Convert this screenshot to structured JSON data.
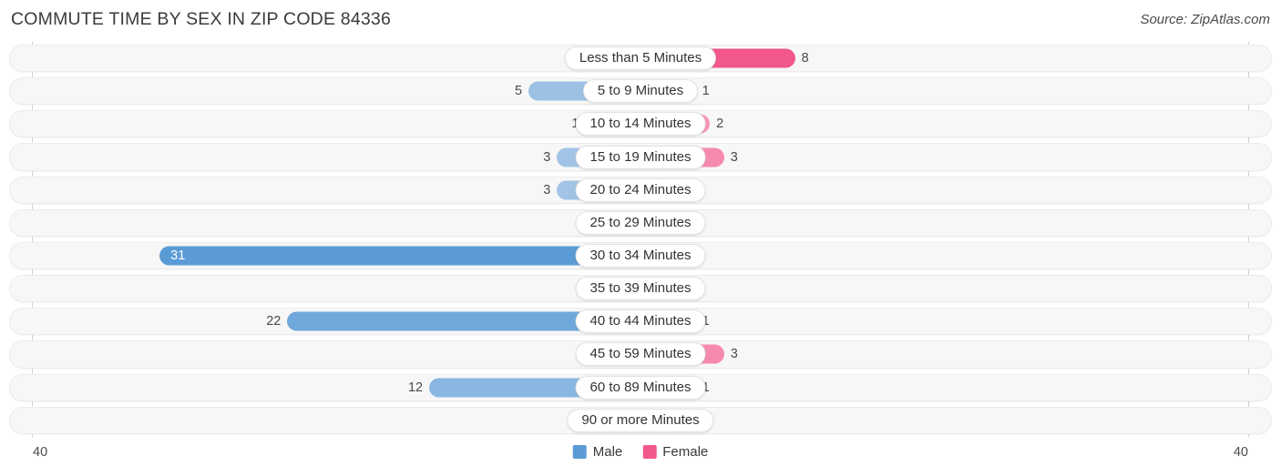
{
  "header": {
    "title": "COMMUTE TIME BY SEX IN ZIP CODE 84336",
    "source": "Source: ZipAtlas.com"
  },
  "legend": {
    "male_label": "Male",
    "female_label": "Female",
    "male_color": "#5b9bd5",
    "female_color": "#f2578d"
  },
  "axis": {
    "left_tick": "40",
    "right_tick": "40"
  },
  "chart_data": {
    "type": "bar",
    "title": "COMMUTE TIME BY SEX IN ZIP CODE 84336",
    "subtitle": "Source: ZipAtlas.com",
    "orientation": "horizontal-diverging",
    "xlabel": "",
    "ylabel": "",
    "xlim": [
      -40,
      40
    ],
    "axis_ticks": [
      "40",
      "40"
    ],
    "grid": false,
    "legend_position": "bottom-center",
    "categories": [
      "Less than 5 Minutes",
      "5 to 9 Minutes",
      "10 to 14 Minutes",
      "15 to 19 Minutes",
      "20 to 24 Minutes",
      "25 to 29 Minutes",
      "30 to 34 Minutes",
      "35 to 39 Minutes",
      "40 to 44 Minutes",
      "45 to 59 Minutes",
      "60 to 89 Minutes",
      "90 or more Minutes"
    ],
    "series": [
      {
        "name": "Male",
        "color": "#5b9bd5",
        "direction": "left",
        "values": [
          0,
          5,
          1,
          3,
          3,
          0,
          31,
          0,
          22,
          0,
          12,
          1
        ]
      },
      {
        "name": "Female",
        "color": "#f2578d",
        "direction": "right",
        "values": [
          8,
          1,
          2,
          3,
          0,
          0,
          0,
          0,
          1,
          3,
          1,
          0
        ]
      }
    ],
    "rows": [
      {
        "category": "Less than 5 Minutes",
        "male": 0,
        "female": 8,
        "male_label": "0",
        "female_label": "8"
      },
      {
        "category": "5 to 9 Minutes",
        "male": 5,
        "female": 1,
        "male_label": "5",
        "female_label": "1"
      },
      {
        "category": "10 to 14 Minutes",
        "male": 1,
        "female": 2,
        "male_label": "1",
        "female_label": "2"
      },
      {
        "category": "15 to 19 Minutes",
        "male": 3,
        "female": 3,
        "male_label": "3",
        "female_label": "3"
      },
      {
        "category": "20 to 24 Minutes",
        "male": 3,
        "female": 0,
        "male_label": "3",
        "female_label": "0"
      },
      {
        "category": "25 to 29 Minutes",
        "male": 0,
        "female": 0,
        "male_label": "0",
        "female_label": "0"
      },
      {
        "category": "30 to 34 Minutes",
        "male": 31,
        "female": 0,
        "male_label": "31",
        "female_label": "0"
      },
      {
        "category": "35 to 39 Minutes",
        "male": 0,
        "female": 0,
        "male_label": "0",
        "female_label": "0"
      },
      {
        "category": "40 to 44 Minutes",
        "male": 22,
        "female": 1,
        "male_label": "22",
        "female_label": "1"
      },
      {
        "category": "45 to 59 Minutes",
        "male": 0,
        "female": 3,
        "male_label": "0",
        "female_label": "3"
      },
      {
        "category": "60 to 89 Minutes",
        "male": 12,
        "female": 1,
        "male_label": "12",
        "female_label": "1"
      },
      {
        "category": "90 or more Minutes",
        "male": 1,
        "female": 0,
        "male_label": "1",
        "female_label": "0"
      }
    ]
  }
}
